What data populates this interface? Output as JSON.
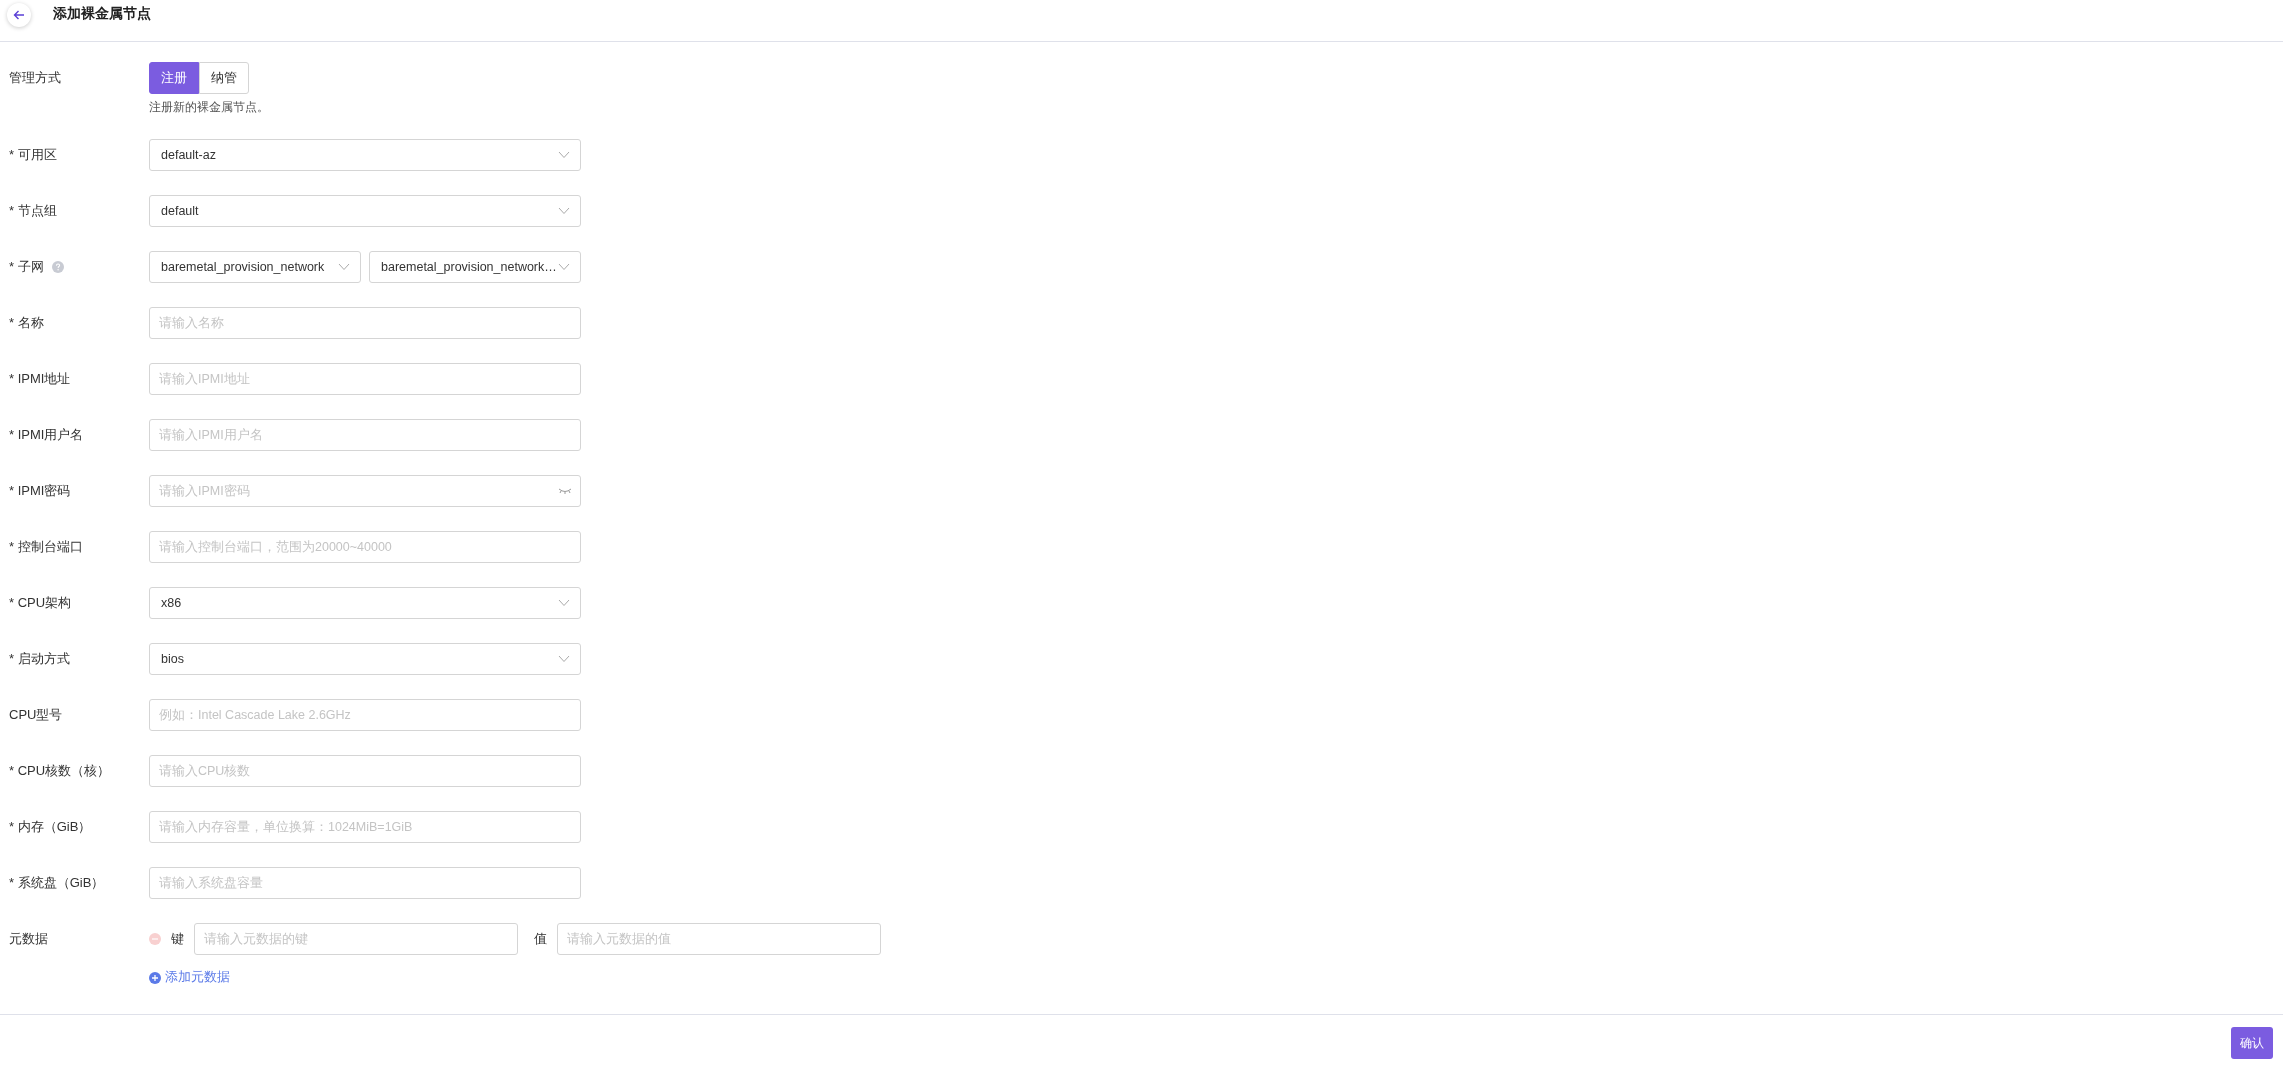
{
  "header": {
    "title": "添加裸金属节点"
  },
  "form": {
    "fields": [
      {
        "kind": "segmented",
        "label": "管理方式",
        "options": [
          {
            "label": "注册",
            "selected": true
          },
          {
            "label": "纳管",
            "selected": false
          }
        ],
        "hint": "注册新的裸金属节点。"
      },
      {
        "kind": "select",
        "label": "* 可用区",
        "value": "default-az"
      },
      {
        "kind": "select",
        "label": "* 节点组",
        "value": "default"
      },
      {
        "kind": "select_pair",
        "label": "* 子网",
        "help": true,
        "values": [
          "baremetal_provision_network",
          "baremetal_provision_network…"
        ]
      },
      {
        "kind": "input",
        "label": "* 名称",
        "placeholder": "请输入名称"
      },
      {
        "kind": "input",
        "label": "* IPMI地址",
        "placeholder": "请输入IPMI地址"
      },
      {
        "kind": "input",
        "label": "* IPMI用户名",
        "placeholder": "请输入IPMI用户名"
      },
      {
        "kind": "password",
        "label": "* IPMI密码",
        "placeholder": "请输入IPMI密码"
      },
      {
        "kind": "input",
        "label": "* 控制台端口",
        "placeholder": "请输入控制台端口，范围为20000~40000"
      },
      {
        "kind": "select",
        "label": "* CPU架构",
        "value": "x86"
      },
      {
        "kind": "select",
        "label": "* 启动方式",
        "value": "bios"
      },
      {
        "kind": "input",
        "label": "CPU型号",
        "placeholder": "例如：Intel Cascade Lake 2.6GHz"
      },
      {
        "kind": "input",
        "label": "* CPU核数（核）",
        "placeholder": "请输入CPU核数"
      },
      {
        "kind": "input",
        "label": "* 内存（GiB）",
        "placeholder": "请输入内存容量，单位换算：1024MiB=1GiB"
      },
      {
        "kind": "input",
        "label": "* 系统盘（GiB）",
        "placeholder": "请输入系统盘容量"
      },
      {
        "kind": "metadata",
        "label": "元数据",
        "pairs": [
          {
            "key_label": "键",
            "key_placeholder": "请输入元数据的键",
            "value_label": "值",
            "value_placeholder": "请输入元数据的值"
          }
        ],
        "add_link": "添加元数据"
      }
    ]
  },
  "footer": {
    "confirm": "确认"
  }
}
